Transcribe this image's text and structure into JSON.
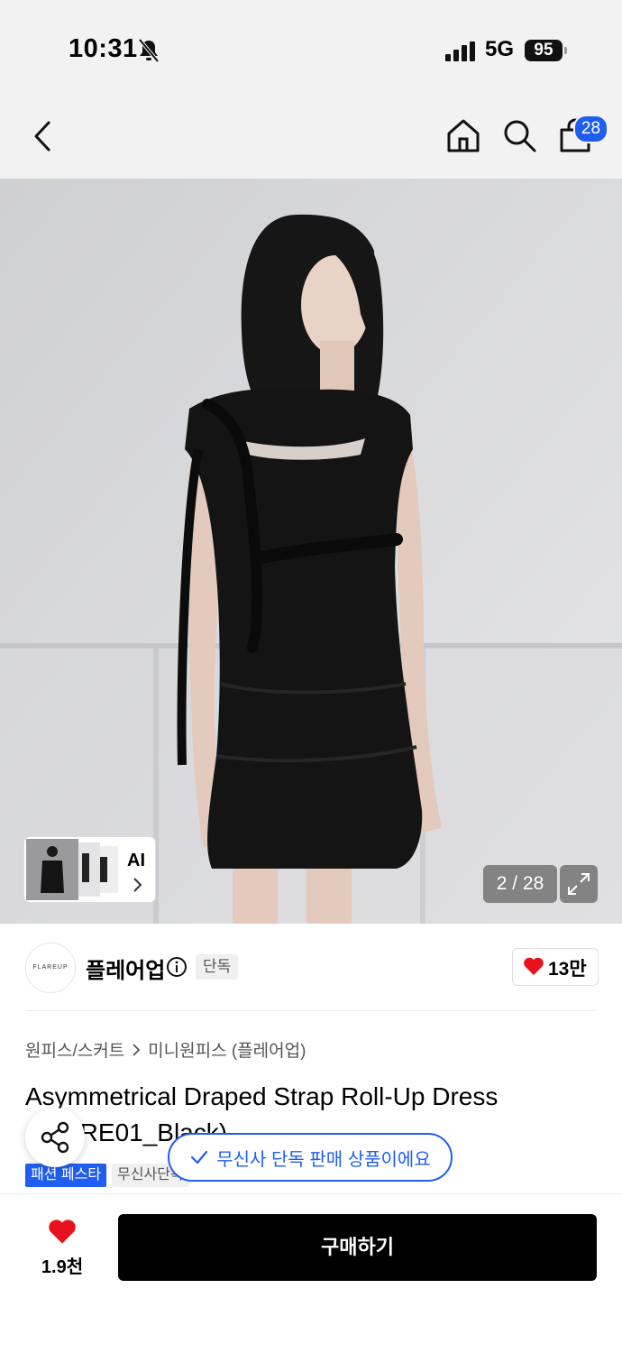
{
  "status_bar": {
    "time": "10:31",
    "network": "5G",
    "battery": "95"
  },
  "nav": {
    "cart_count": "28"
  },
  "gallery": {
    "ai_label": "AI",
    "counter": "2 / 28"
  },
  "brand": {
    "logo_text": "FLAREUP",
    "name": "플레어업",
    "exclusive_tag": "단독",
    "like_count": "13만"
  },
  "breadcrumb": {
    "category": "원피스/스커트",
    "subcategory": "미니원피스 (플레어업)"
  },
  "product": {
    "title": "Asymmetrical Draped Strap Roll-Up Dress (FLARE01_Black)",
    "tags": [
      "패션 페스타",
      "무신사단독"
    ]
  },
  "toast": {
    "text": "무신사 단독 판매 상품이에요"
  },
  "bottom_bar": {
    "wish_count": "1.9천",
    "buy_label": "구매하기"
  },
  "colors": {
    "accent_blue": "#1f5ef0",
    "heart_red": "#e8121e",
    "buy_button": "#000000"
  }
}
